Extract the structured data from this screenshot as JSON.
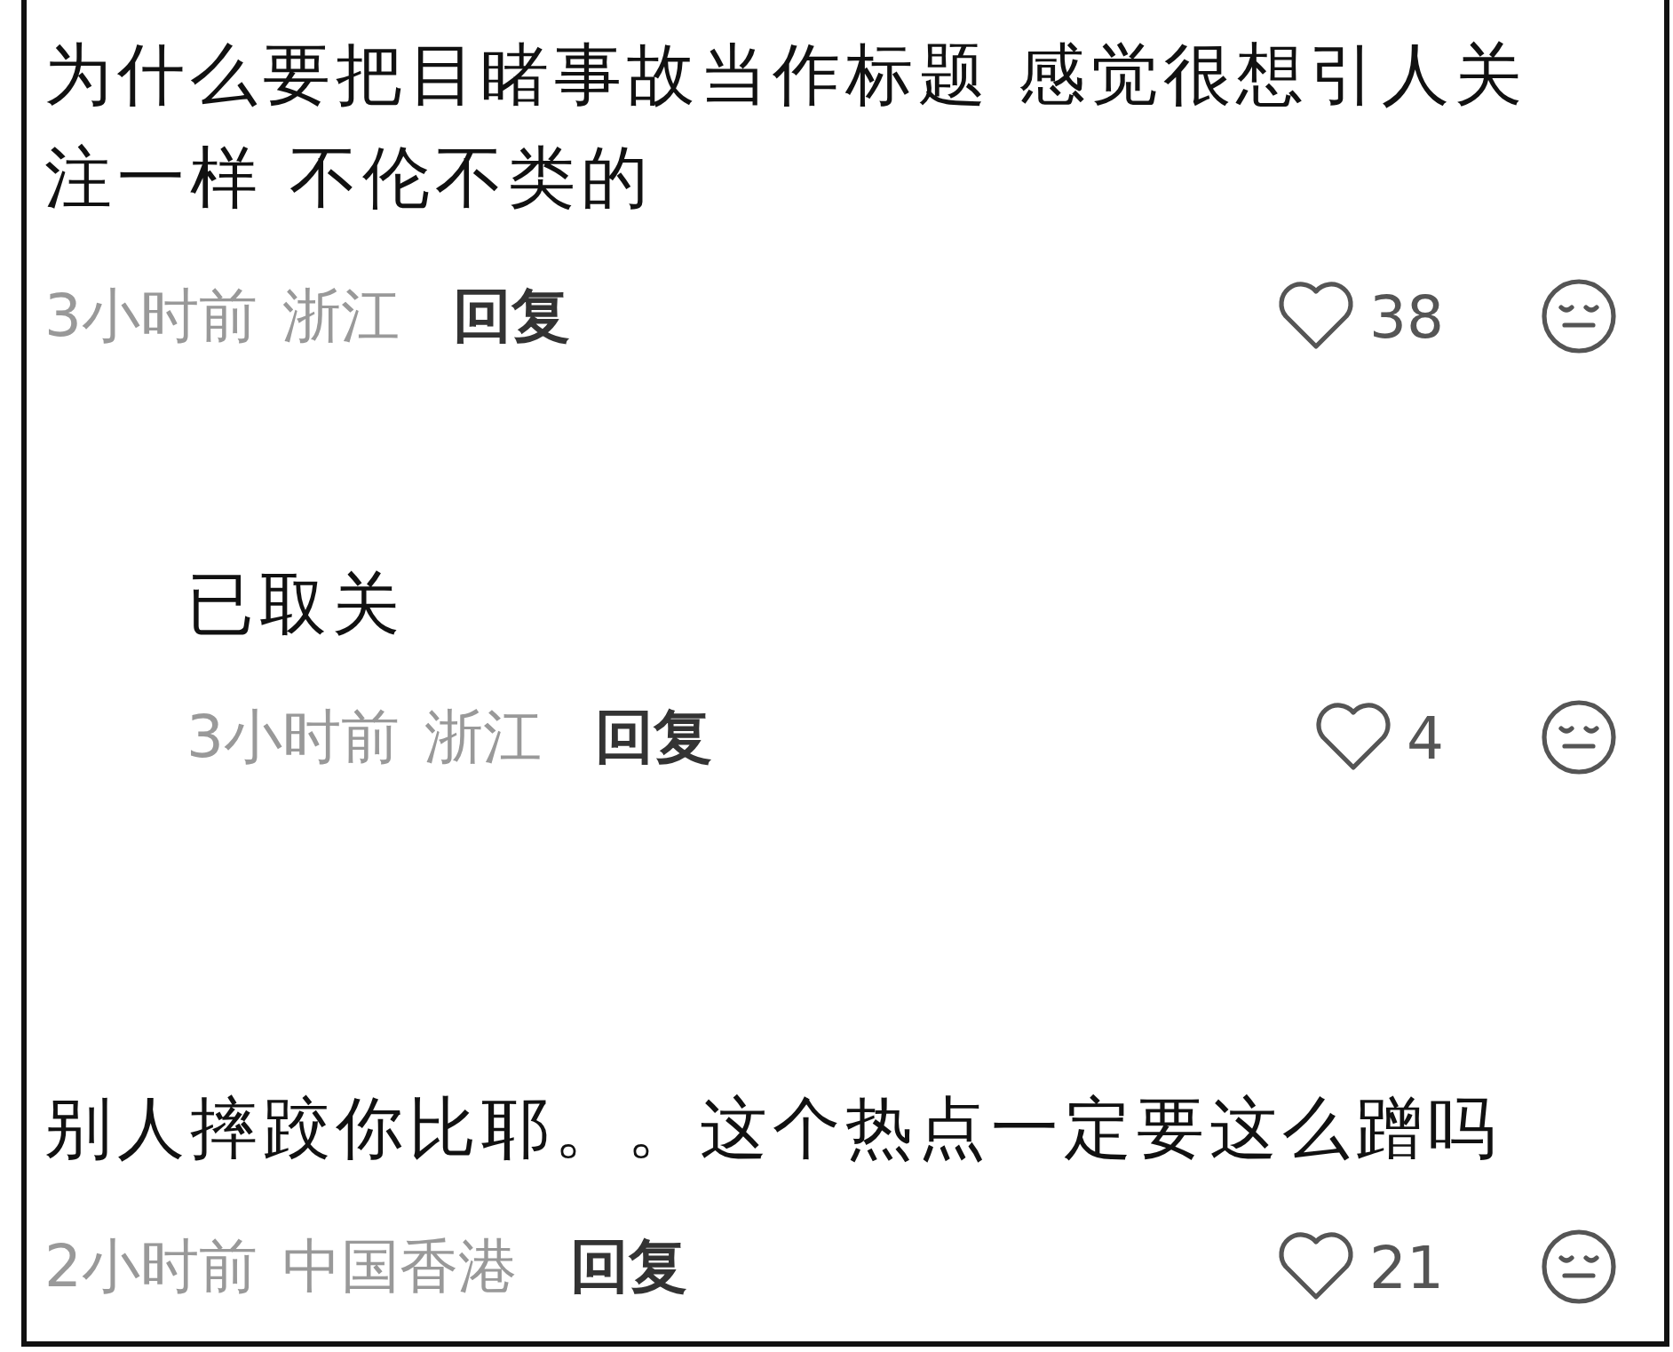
{
  "comments": [
    {
      "text": "为什么要把目睹事故当作标题 感觉很想引人关注一样 不伦不类的",
      "time": "3小时前",
      "location": "浙江",
      "reply_label": "回复",
      "likes": "38",
      "children": [
        {
          "text": "已取关",
          "time": "3小时前",
          "location": "浙江",
          "reply_label": "回复",
          "likes": "4"
        }
      ]
    },
    {
      "text": "别人摔跤你比耶。。这个热点一定要这么蹭吗",
      "time": "2小时前",
      "location": "中国香港",
      "reply_label": "回复",
      "likes": "21"
    }
  ]
}
